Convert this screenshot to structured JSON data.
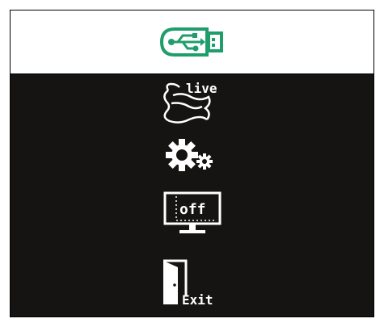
{
  "menu": {
    "selected_index": 0,
    "items": [
      {
        "icon": "usb-drive-icon",
        "label": ""
      },
      {
        "icon": "live-scroll-icon",
        "label": "live"
      },
      {
        "icon": "gears-icon",
        "label": ""
      },
      {
        "icon": "display-off-icon",
        "label": "off"
      },
      {
        "icon": "exit-door-icon",
        "label": "Exit"
      }
    ]
  },
  "colors": {
    "background": "#151413",
    "selected_background": "#ffffff",
    "accent": "#1f9e6b",
    "icon": "#ffffff"
  }
}
